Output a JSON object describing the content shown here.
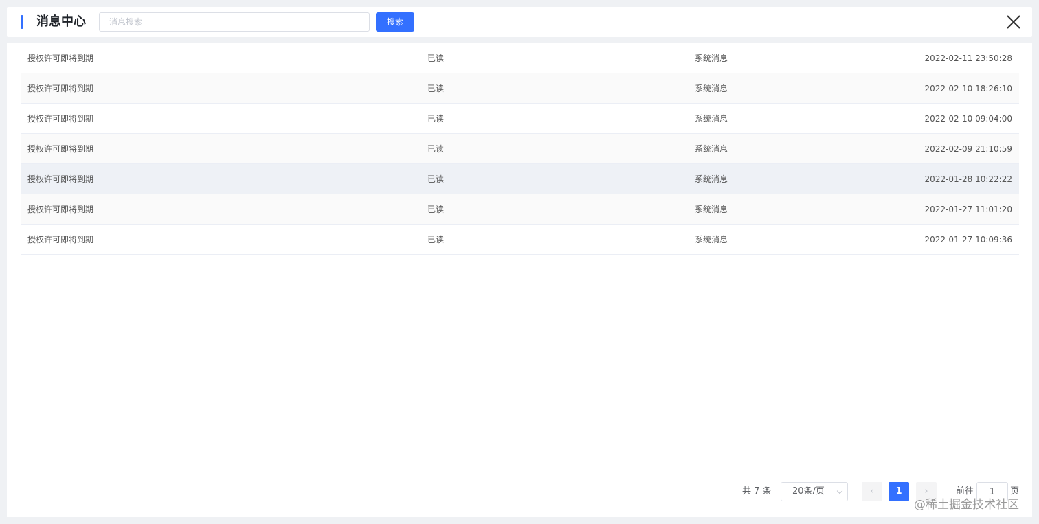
{
  "header": {
    "title": "消息中心",
    "search_placeholder": "消息搜索",
    "search_value": "",
    "search_label": "搜索"
  },
  "messages": [
    {
      "title": "授权许可即将到期",
      "status": "已读",
      "type": "系统消息",
      "time": "2022-02-11 23:50:28"
    },
    {
      "title": "授权许可即将到期",
      "status": "已读",
      "type": "系统消息",
      "time": "2022-02-10 18:26:10"
    },
    {
      "title": "授权许可即将到期",
      "status": "已读",
      "type": "系统消息",
      "time": "2022-02-10 09:04:00"
    },
    {
      "title": "授权许可即将到期",
      "status": "已读",
      "type": "系统消息",
      "time": "2022-02-09 21:10:59"
    },
    {
      "title": "授权许可即将到期",
      "status": "已读",
      "type": "系统消息",
      "time": "2022-01-28 10:22:22"
    },
    {
      "title": "授权许可即将到期",
      "status": "已读",
      "type": "系统消息",
      "time": "2022-01-27 11:01:20"
    },
    {
      "title": "授权许可即将到期",
      "status": "已读",
      "type": "系统消息",
      "time": "2022-01-27 10:09:36"
    }
  ],
  "pagination": {
    "total_text": "共 7 条",
    "page_size": "20条/页",
    "current_page": "1",
    "goto_label": "前往",
    "goto_value": "1",
    "page_unit": "页",
    "prev_icon": "‹",
    "next_icon": "›"
  },
  "watermark": "@稀土掘金技术社区",
  "colors": {
    "accent": "#3370ff",
    "background": "#eff1f4",
    "row_hover": "#eef1f6"
  }
}
